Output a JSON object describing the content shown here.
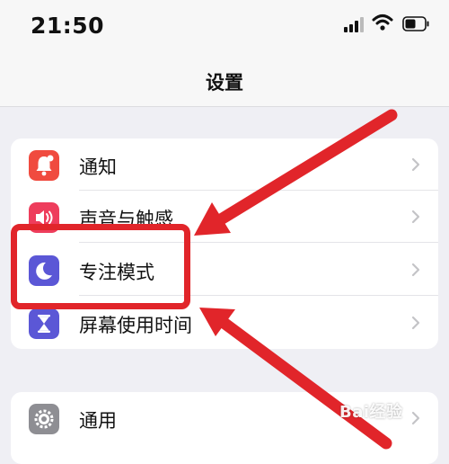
{
  "status_bar": {
    "time": "21:50"
  },
  "nav": {
    "title": "设置"
  },
  "settings_group_1": [
    {
      "label": "通知",
      "icon": "notification-bell-icon",
      "color": "#f04b3f"
    },
    {
      "label": "声音与触感",
      "icon": "speaker-icon",
      "color": "#ee3d5c"
    },
    {
      "label": "专注模式",
      "icon": "moon-icon",
      "color": "#5b57d6"
    },
    {
      "label": "屏幕使用时间",
      "icon": "hourglass-icon",
      "color": "#5b57d6"
    }
  ],
  "settings_group_2": [
    {
      "label": "通用",
      "icon": "gear-icon",
      "color": "#8e8e93"
    }
  ],
  "annotation": {
    "color": "#e1252a"
  },
  "watermark": {
    "text": "Bai经验"
  }
}
